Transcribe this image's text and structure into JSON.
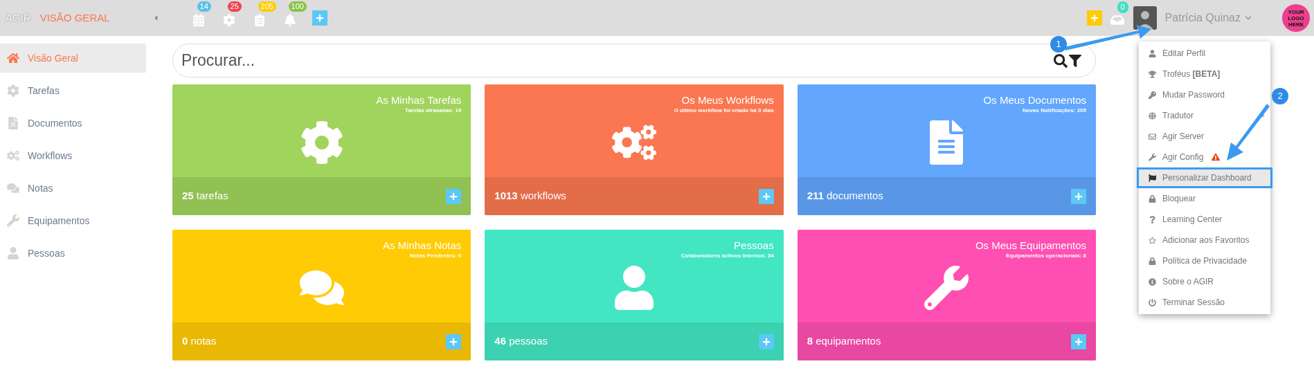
{
  "topbar": {
    "brand": "AGIR",
    "page_title": "VISÃO GERAL",
    "notifications": [
      {
        "kind": "calendar",
        "count": "14",
        "color": "#5bc0eb"
      },
      {
        "kind": "tasks",
        "count": "25",
        "color": "#f0434f"
      },
      {
        "kind": "documents",
        "count": "205",
        "color": "#ffcc00"
      },
      {
        "kind": "alerts",
        "count": "100",
        "color": "#8bc34a"
      }
    ],
    "inbox_count": "0",
    "user_name": "Patrícia Quinaz",
    "logo": "YOUR LOGO HERE"
  },
  "sidebar": {
    "items": [
      {
        "label": "Visão Geral",
        "kind": "home",
        "selected": true
      },
      {
        "label": "Tarefas",
        "kind": "cog",
        "selected": false
      },
      {
        "label": "Documentos",
        "kind": "file",
        "selected": false
      },
      {
        "label": "Workflows",
        "kind": "cogs",
        "selected": false
      },
      {
        "label": "Notas",
        "kind": "comments",
        "selected": false
      },
      {
        "label": "Equipamentos",
        "kind": "wrench",
        "selected": false
      },
      {
        "label": "Pessoas",
        "kind": "user",
        "selected": false
      }
    ]
  },
  "search": {
    "placeholder": "Procurar..."
  },
  "cards": [
    {
      "title": "As Minhas Tarefas",
      "subtitle": "Tarefas atrasadas: 19",
      "count": "25",
      "unit": "tarefas",
      "kind": "cog",
      "color": "#a0d45c"
    },
    {
      "title": "Os Meus Workflows",
      "subtitle": "O último workflow foi criado há 0 dias",
      "count": "1013",
      "unit": "workflows",
      "kind": "cogs",
      "color": "#fa7751"
    },
    {
      "title": "Os Meus Documentos",
      "subtitle": "Novas Notificações: 205",
      "count": "211",
      "unit": "documentos",
      "kind": "file",
      "color": "#62a6fd"
    },
    {
      "title": "As Minhas Notas",
      "subtitle": "Notas Pendentes: 0",
      "count": "0",
      "unit": "notas",
      "kind": "comments",
      "color": "#ffcb05"
    },
    {
      "title": "Pessoas",
      "subtitle": "Colaboradores activos internos: 34",
      "count": "46",
      "unit": "pessoas",
      "kind": "user",
      "color": "#43e6c2"
    },
    {
      "title": "Os Meus Equipamentos",
      "subtitle": "Equipamentos operacionais: 8",
      "count": "8",
      "unit": "equipamentos",
      "kind": "wrench",
      "color": "#ff4fb2"
    }
  ],
  "user_menu": {
    "items": [
      {
        "label": "Editar Perfil",
        "kind": "user",
        "selected": false
      },
      {
        "label": "Troféus **[BETA]**",
        "kind": "trophy",
        "selected": false
      },
      {
        "label": "Mudar Password",
        "kind": "key",
        "selected": false
      },
      {
        "label": "Tradutor",
        "kind": "globe",
        "selected": false,
        "submenu": true
      },
      {
        "label": "Agir Server",
        "kind": "envelope",
        "selected": false
      },
      {
        "label": "Agir Config",
        "kind": "wrench",
        "selected": false,
        "warning": true
      },
      {
        "label": "Personalizar Dashboard",
        "kind": "flag",
        "selected": true
      },
      {
        "label": "Bloquear",
        "kind": "lock",
        "selected": false
      },
      {
        "label": "Learning Center",
        "kind": "question",
        "selected": false
      },
      {
        "label": "Adicionar aos Favoritos",
        "kind": "star",
        "selected": false
      },
      {
        "label": "Política de Privacidade",
        "kind": "lock",
        "selected": false
      },
      {
        "label": "Sobre o AGIR",
        "kind": "info",
        "selected": false
      },
      {
        "label": "Terminar Sessão",
        "kind": "power",
        "selected": false
      }
    ]
  },
  "callouts": [
    "1",
    "2"
  ]
}
